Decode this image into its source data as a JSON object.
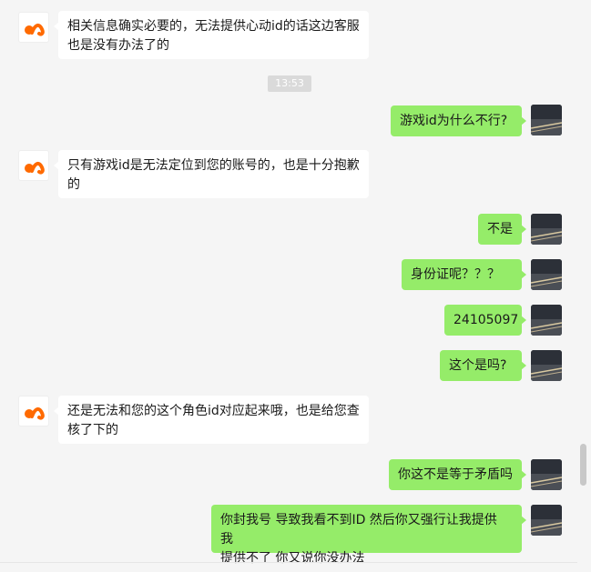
{
  "timestamp": "13:53",
  "messages": [
    {
      "side": "left",
      "text": "相关信息确实必要的，无法提供心动id的话这边客服\n也是没有办法了的"
    },
    {
      "side": "right",
      "text": "游戏id为什么不行?"
    },
    {
      "side": "left",
      "text": "只有游戏id是无法定位到您的账号的，也是十分抱歉\n的"
    },
    {
      "side": "right",
      "text": "不是"
    },
    {
      "side": "right",
      "text": "身份证呢？？？"
    },
    {
      "side": "right",
      "text": "24105097"
    },
    {
      "side": "right",
      "text": "这个是吗?"
    },
    {
      "side": "left",
      "text": "还是无法和您的这个角色id对应起来哦，也是给您查\n核了下的"
    },
    {
      "side": "right",
      "text": "你这不是等于矛盾吗"
    },
    {
      "side": "right",
      "text": "你封我号 导致我看不到ID 然后你又强行让我提供 我\n提供不了 你又说你没办法"
    }
  ],
  "colors": {
    "self_bubble": "#95ec69",
    "other_bubble": "#ffffff",
    "background": "#f5f5f5",
    "logo": "#ff6a00"
  }
}
